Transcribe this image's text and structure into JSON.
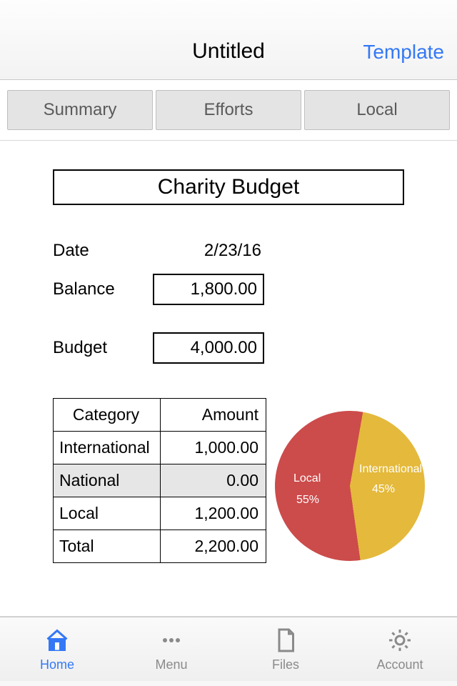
{
  "header": {
    "title": "Untitled",
    "action": "Template"
  },
  "tabs": {
    "items": [
      {
        "label": "Summary"
      },
      {
        "label": "Efforts"
      },
      {
        "label": "Local"
      }
    ]
  },
  "sheet": {
    "title": "Charity Budget",
    "date_label": "Date",
    "date_value": "2/23/16",
    "balance_label": "Balance",
    "balance_value": "1,800.00",
    "budget_label": "Budget",
    "budget_value": "4,000.00",
    "table": {
      "col_category": "Category",
      "col_amount": "Amount",
      "rows": [
        {
          "category": "International",
          "amount": "1,000.00"
        },
        {
          "category": "National",
          "amount": "0.00"
        },
        {
          "category": "Local",
          "amount": "1,200.00"
        }
      ],
      "total_label": "Total",
      "total_value": "2,200.00"
    }
  },
  "chart_data": {
    "type": "pie",
    "title": "",
    "series": [
      {
        "name": "Local",
        "value": 55,
        "color": "#cc4b4b"
      },
      {
        "name": "International",
        "value": 45,
        "color": "#e4b93c"
      }
    ],
    "labels": {
      "local_name": "Local",
      "local_pct": "55%",
      "intl_name": "International",
      "intl_pct": "45%"
    }
  },
  "bottom_tabs": {
    "home": "Home",
    "menu": "Menu",
    "files": "Files",
    "account": "Account"
  },
  "colors": {
    "accent": "#3478f6",
    "pie_local": "#cc4b4b",
    "pie_intl": "#e4b93c"
  }
}
